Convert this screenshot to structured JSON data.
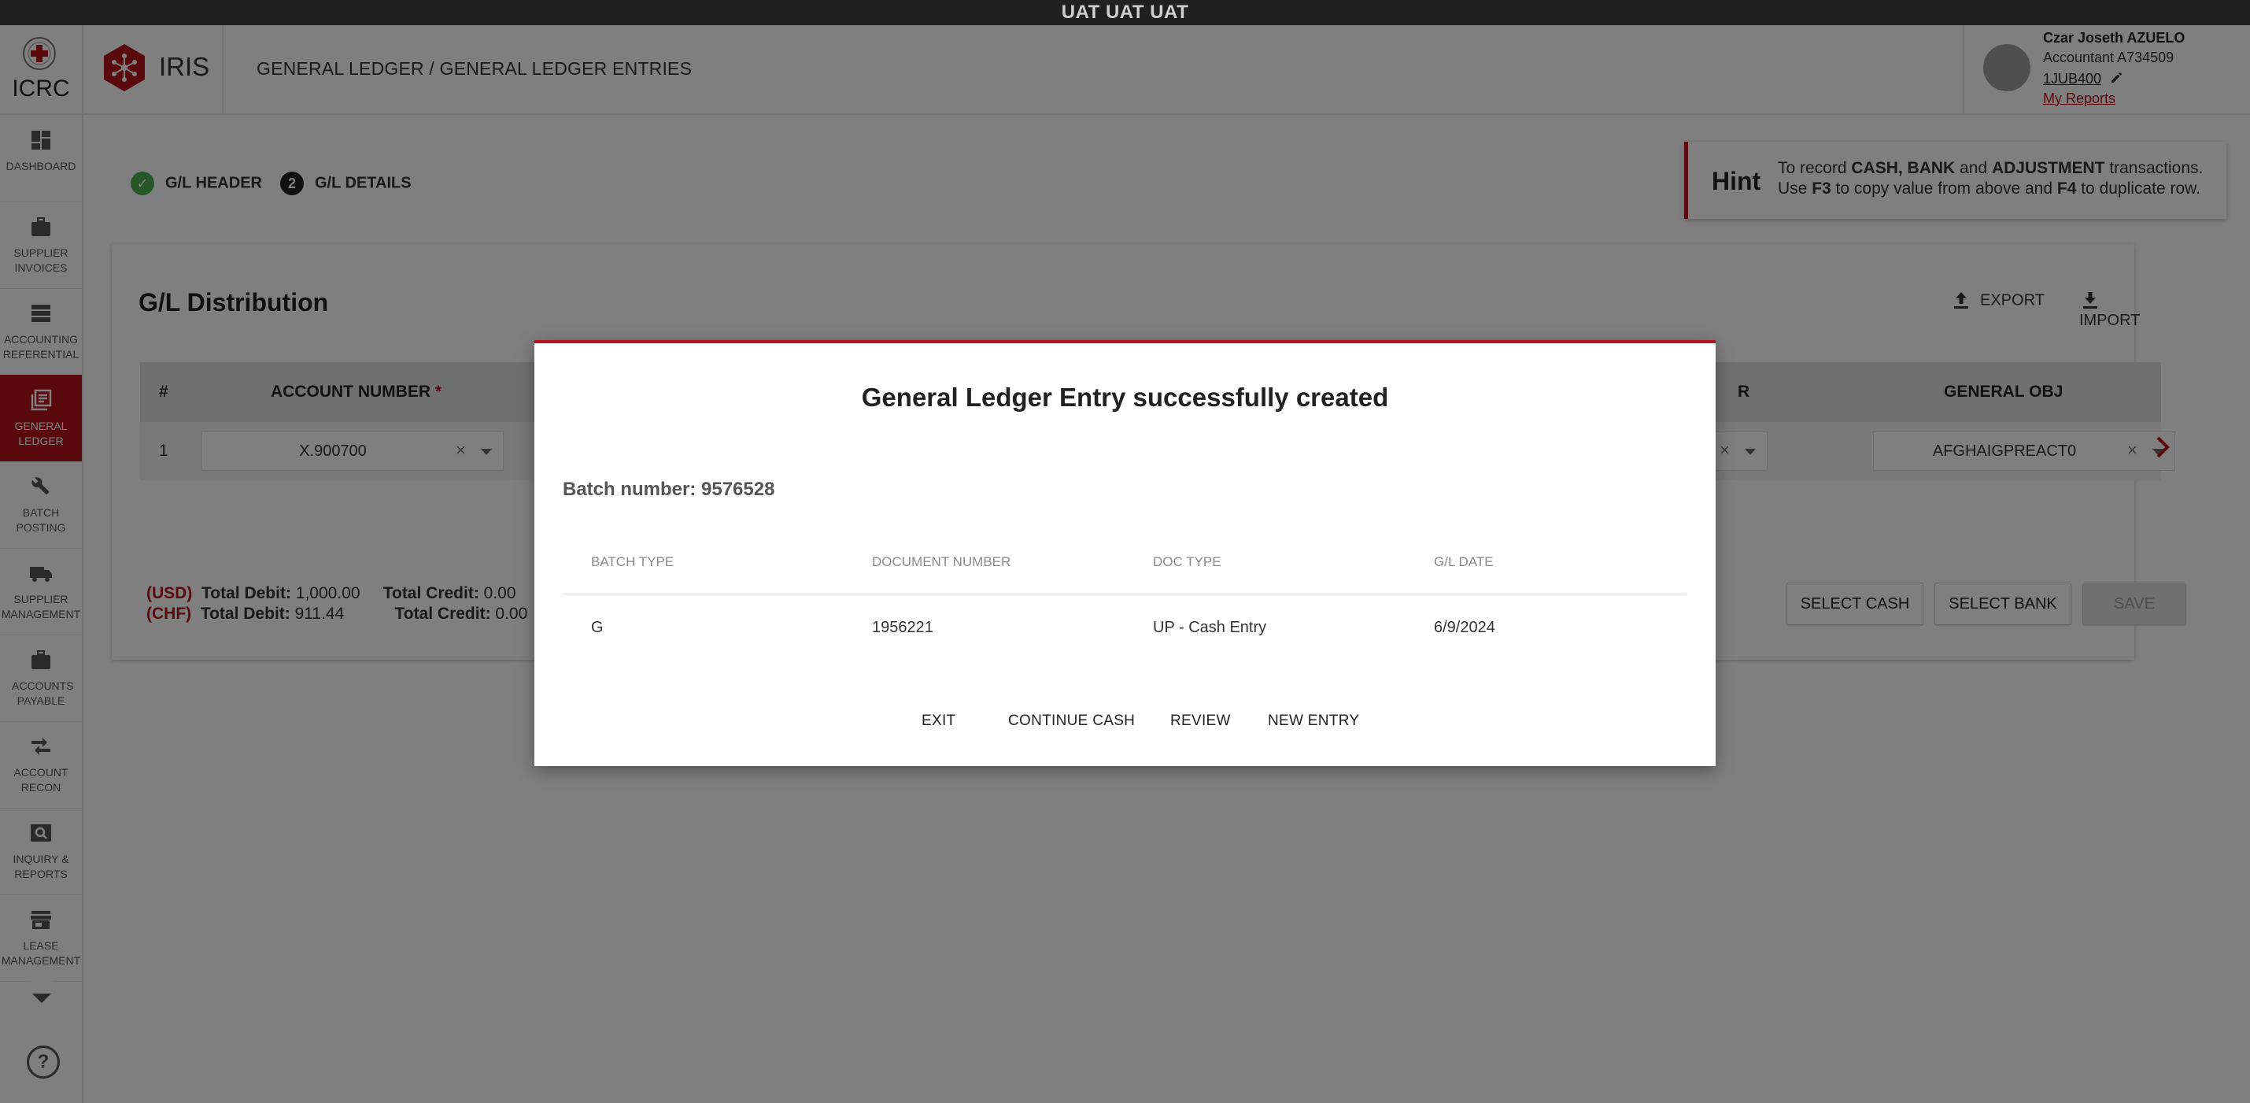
{
  "env_banner": "UAT UAT UAT",
  "header": {
    "org_name": "ICRC",
    "app_name": "IRIS",
    "breadcrumb": "GENERAL LEDGER / GENERAL LEDGER ENTRIES",
    "user": {
      "name": "Czar Joseth AZUELO",
      "role": "Accountant A734509",
      "code": "1JUB400",
      "reports_link": "My Reports"
    }
  },
  "sidebar": {
    "items": [
      {
        "label": "DASHBOARD",
        "icon": "dashboard-icon",
        "active": false
      },
      {
        "label": "SUPPLIER INVOICES",
        "icon": "briefcase-icon",
        "active": false
      },
      {
        "label": "ACCOUNTING REFERENTIAL",
        "icon": "storage-icon",
        "active": false
      },
      {
        "label": "GENERAL LEDGER",
        "icon": "ledger-icon",
        "active": true
      },
      {
        "label": "BATCH POSTING",
        "icon": "wrench-icon",
        "active": false
      },
      {
        "label": "SUPPLIER MANAGEMENT",
        "icon": "truck-icon",
        "active": false
      },
      {
        "label": "ACCOUNTS PAYABLE",
        "icon": "briefcase-icon",
        "active": false
      },
      {
        "label": "ACCOUNT RECON",
        "icon": "compare-arrows-icon",
        "active": false
      },
      {
        "label": "INQUIRY & REPORTS",
        "icon": "search-report-icon",
        "active": false
      },
      {
        "label": "LEASE MANAGEMENT",
        "icon": "store-icon",
        "active": false
      }
    ],
    "help": "?"
  },
  "steps": {
    "step1": {
      "label": "G/L HEADER",
      "state": "done"
    },
    "step2": {
      "label": "G/L DETAILS",
      "number": "2",
      "state": "current"
    }
  },
  "hint": {
    "title": "Hint",
    "line1": {
      "a": "To record ",
      "b1": "CASH, BANK",
      "c": " and ",
      "b2": "ADJUSTMENT",
      "d": " transactions."
    },
    "line2": {
      "a": "Use ",
      "b1": "F3",
      "c": " to copy value from above and ",
      "b2": "F4",
      "d": " to duplicate row."
    }
  },
  "card": {
    "title": "G/L Distribution",
    "export_label": "EXPORT",
    "import_label": "IMPORT",
    "columns": {
      "num": "#",
      "account": "ACCOUNT NUMBER",
      "required_mark": "*",
      "partial": "R",
      "general_obj": "GENERAL OBJ"
    },
    "row": {
      "num": "1",
      "account": "X.900700",
      "general_obj": "AFGHAIGPREACT0"
    },
    "totals": [
      {
        "currency": "(USD)",
        "debit_label": "Total Debit:",
        "debit": "1,000.00",
        "credit_label": "Total Credit:",
        "credit": "0.00"
      },
      {
        "currency": "(CHF)",
        "debit_label": "Total Debit:",
        "debit": "911.44",
        "credit_label": "Total Credit:",
        "credit": "0.00"
      }
    ],
    "buttons": {
      "select_cash": "SELECT CASH",
      "select_bank": "SELECT BANK",
      "save": "SAVE"
    }
  },
  "dialog": {
    "title": "General Ledger Entry successfully created",
    "batch_number": "Batch number: 9576528",
    "columns": [
      "BATCH TYPE",
      "DOCUMENT NUMBER",
      "DOC TYPE",
      "G/L DATE"
    ],
    "row": [
      "G",
      "1956221",
      "UP - Cash Entry",
      "6/9/2024"
    ],
    "buttons": {
      "exit": "EXIT",
      "continue_cash": "CONTINUE CASH",
      "review": "REVIEW",
      "new_entry": "NEW ENTRY"
    }
  },
  "colors": {
    "brand_red": "#b5121b",
    "success_green": "#4caf50",
    "overlay": "rgba(0,0,0,0.5)"
  }
}
